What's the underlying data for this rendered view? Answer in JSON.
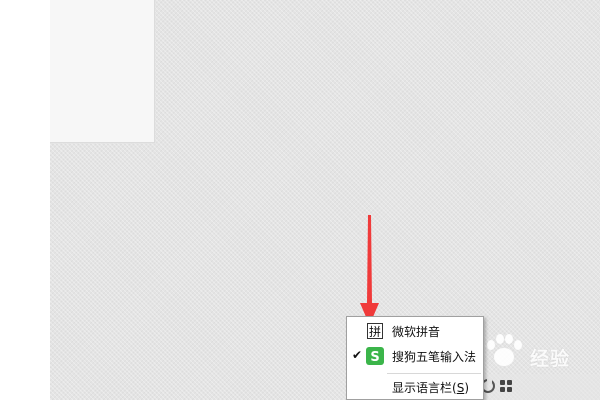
{
  "context_menu": {
    "items": [
      {
        "label": "微软拼音",
        "icon_text": "拼",
        "checked": false,
        "check_mark": ""
      },
      {
        "label": "搜狗五笔输入法",
        "icon": "sogou-icon",
        "checked": true,
        "check_mark": "✔"
      },
      {
        "label_prefix": "显示语言栏(",
        "label_accel": "S",
        "label_suffix": ")",
        "checked": false,
        "check_mark": ""
      }
    ]
  },
  "watermark": {
    "text": "经验"
  },
  "colors": {
    "arrow": "#f03a3a",
    "sogou_green": "#3bb54a",
    "menu_border": "#a0a0a0"
  }
}
